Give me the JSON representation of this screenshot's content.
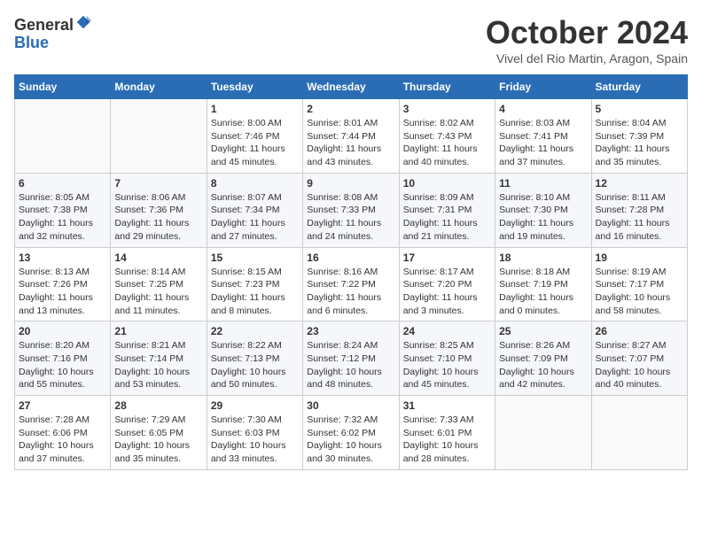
{
  "logo": {
    "general": "General",
    "blue": "Blue"
  },
  "header": {
    "month_title": "October 2024",
    "location": "Vivel del Rio Martin, Aragon, Spain"
  },
  "weekdays": [
    "Sunday",
    "Monday",
    "Tuesday",
    "Wednesday",
    "Thursday",
    "Friday",
    "Saturday"
  ],
  "weeks": [
    [
      {
        "day": "",
        "info": ""
      },
      {
        "day": "",
        "info": ""
      },
      {
        "day": "1",
        "info": "Sunrise: 8:00 AM\nSunset: 7:46 PM\nDaylight: 11 hours and 45 minutes."
      },
      {
        "day": "2",
        "info": "Sunrise: 8:01 AM\nSunset: 7:44 PM\nDaylight: 11 hours and 43 minutes."
      },
      {
        "day": "3",
        "info": "Sunrise: 8:02 AM\nSunset: 7:43 PM\nDaylight: 11 hours and 40 minutes."
      },
      {
        "day": "4",
        "info": "Sunrise: 8:03 AM\nSunset: 7:41 PM\nDaylight: 11 hours and 37 minutes."
      },
      {
        "day": "5",
        "info": "Sunrise: 8:04 AM\nSunset: 7:39 PM\nDaylight: 11 hours and 35 minutes."
      }
    ],
    [
      {
        "day": "6",
        "info": "Sunrise: 8:05 AM\nSunset: 7:38 PM\nDaylight: 11 hours and 32 minutes."
      },
      {
        "day": "7",
        "info": "Sunrise: 8:06 AM\nSunset: 7:36 PM\nDaylight: 11 hours and 29 minutes."
      },
      {
        "day": "8",
        "info": "Sunrise: 8:07 AM\nSunset: 7:34 PM\nDaylight: 11 hours and 27 minutes."
      },
      {
        "day": "9",
        "info": "Sunrise: 8:08 AM\nSunset: 7:33 PM\nDaylight: 11 hours and 24 minutes."
      },
      {
        "day": "10",
        "info": "Sunrise: 8:09 AM\nSunset: 7:31 PM\nDaylight: 11 hours and 21 minutes."
      },
      {
        "day": "11",
        "info": "Sunrise: 8:10 AM\nSunset: 7:30 PM\nDaylight: 11 hours and 19 minutes."
      },
      {
        "day": "12",
        "info": "Sunrise: 8:11 AM\nSunset: 7:28 PM\nDaylight: 11 hours and 16 minutes."
      }
    ],
    [
      {
        "day": "13",
        "info": "Sunrise: 8:13 AM\nSunset: 7:26 PM\nDaylight: 11 hours and 13 minutes."
      },
      {
        "day": "14",
        "info": "Sunrise: 8:14 AM\nSunset: 7:25 PM\nDaylight: 11 hours and 11 minutes."
      },
      {
        "day": "15",
        "info": "Sunrise: 8:15 AM\nSunset: 7:23 PM\nDaylight: 11 hours and 8 minutes."
      },
      {
        "day": "16",
        "info": "Sunrise: 8:16 AM\nSunset: 7:22 PM\nDaylight: 11 hours and 6 minutes."
      },
      {
        "day": "17",
        "info": "Sunrise: 8:17 AM\nSunset: 7:20 PM\nDaylight: 11 hours and 3 minutes."
      },
      {
        "day": "18",
        "info": "Sunrise: 8:18 AM\nSunset: 7:19 PM\nDaylight: 11 hours and 0 minutes."
      },
      {
        "day": "19",
        "info": "Sunrise: 8:19 AM\nSunset: 7:17 PM\nDaylight: 10 hours and 58 minutes."
      }
    ],
    [
      {
        "day": "20",
        "info": "Sunrise: 8:20 AM\nSunset: 7:16 PM\nDaylight: 10 hours and 55 minutes."
      },
      {
        "day": "21",
        "info": "Sunrise: 8:21 AM\nSunset: 7:14 PM\nDaylight: 10 hours and 53 minutes."
      },
      {
        "day": "22",
        "info": "Sunrise: 8:22 AM\nSunset: 7:13 PM\nDaylight: 10 hours and 50 minutes."
      },
      {
        "day": "23",
        "info": "Sunrise: 8:24 AM\nSunset: 7:12 PM\nDaylight: 10 hours and 48 minutes."
      },
      {
        "day": "24",
        "info": "Sunrise: 8:25 AM\nSunset: 7:10 PM\nDaylight: 10 hours and 45 minutes."
      },
      {
        "day": "25",
        "info": "Sunrise: 8:26 AM\nSunset: 7:09 PM\nDaylight: 10 hours and 42 minutes."
      },
      {
        "day": "26",
        "info": "Sunrise: 8:27 AM\nSunset: 7:07 PM\nDaylight: 10 hours and 40 minutes."
      }
    ],
    [
      {
        "day": "27",
        "info": "Sunrise: 7:28 AM\nSunset: 6:06 PM\nDaylight: 10 hours and 37 minutes."
      },
      {
        "day": "28",
        "info": "Sunrise: 7:29 AM\nSunset: 6:05 PM\nDaylight: 10 hours and 35 minutes."
      },
      {
        "day": "29",
        "info": "Sunrise: 7:30 AM\nSunset: 6:03 PM\nDaylight: 10 hours and 33 minutes."
      },
      {
        "day": "30",
        "info": "Sunrise: 7:32 AM\nSunset: 6:02 PM\nDaylight: 10 hours and 30 minutes."
      },
      {
        "day": "31",
        "info": "Sunrise: 7:33 AM\nSunset: 6:01 PM\nDaylight: 10 hours and 28 minutes."
      },
      {
        "day": "",
        "info": ""
      },
      {
        "day": "",
        "info": ""
      }
    ]
  ]
}
